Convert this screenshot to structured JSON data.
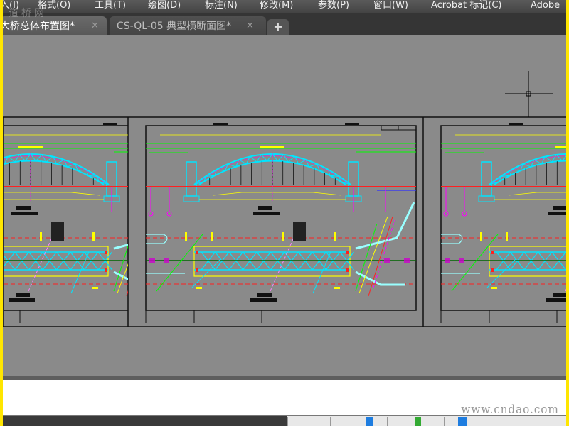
{
  "menubar": {
    "items": [
      "入(I)",
      "格式(O)",
      "工具(T)",
      "绘图(D)",
      "标注(N)",
      "修改(M)",
      "参数(P)",
      "窗口(W)",
      "Acrobat 标记(C)",
      "Adobe"
    ]
  },
  "tabs": [
    {
      "label": "大桥总体布置图*",
      "active": true,
      "close": "✕"
    },
    {
      "label": "CS-QL-05 典型横断面图*",
      "active": false,
      "close": "✕"
    }
  ],
  "add_tab": "+",
  "watermarks": {
    "top": "道桥网",
    "bottom": "www.cndao.com"
  },
  "colors": {
    "canvas": "#8a8a8a",
    "cyan": "#00e5ff",
    "red": "#ff2020",
    "yellow": "#ffff00",
    "green": "#00ff00",
    "magenta": "#ff00ff",
    "border": "#ffe600"
  }
}
